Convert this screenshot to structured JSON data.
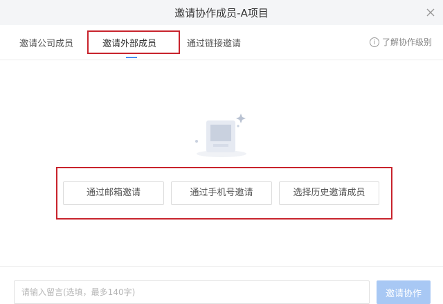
{
  "dialog": {
    "title": "邀请协作成员-A项目"
  },
  "tabs": [
    {
      "label": "邀请公司成员"
    },
    {
      "label": "邀请外部成员"
    },
    {
      "label": "通过链接邀请"
    }
  ],
  "help_link": "了解协作级别",
  "options": [
    {
      "label": "通过邮箱邀请"
    },
    {
      "label": "通过手机号邀请"
    },
    {
      "label": "选择历史邀请成员"
    }
  ],
  "footer": {
    "message_placeholder": "请输入留言(选填，最多140字)",
    "invite_label": "邀请协作"
  },
  "colors": {
    "accent": "#4a8cf0",
    "invite_button_disabled": "#a8c8f4",
    "highlight_border": "#c8232c"
  }
}
